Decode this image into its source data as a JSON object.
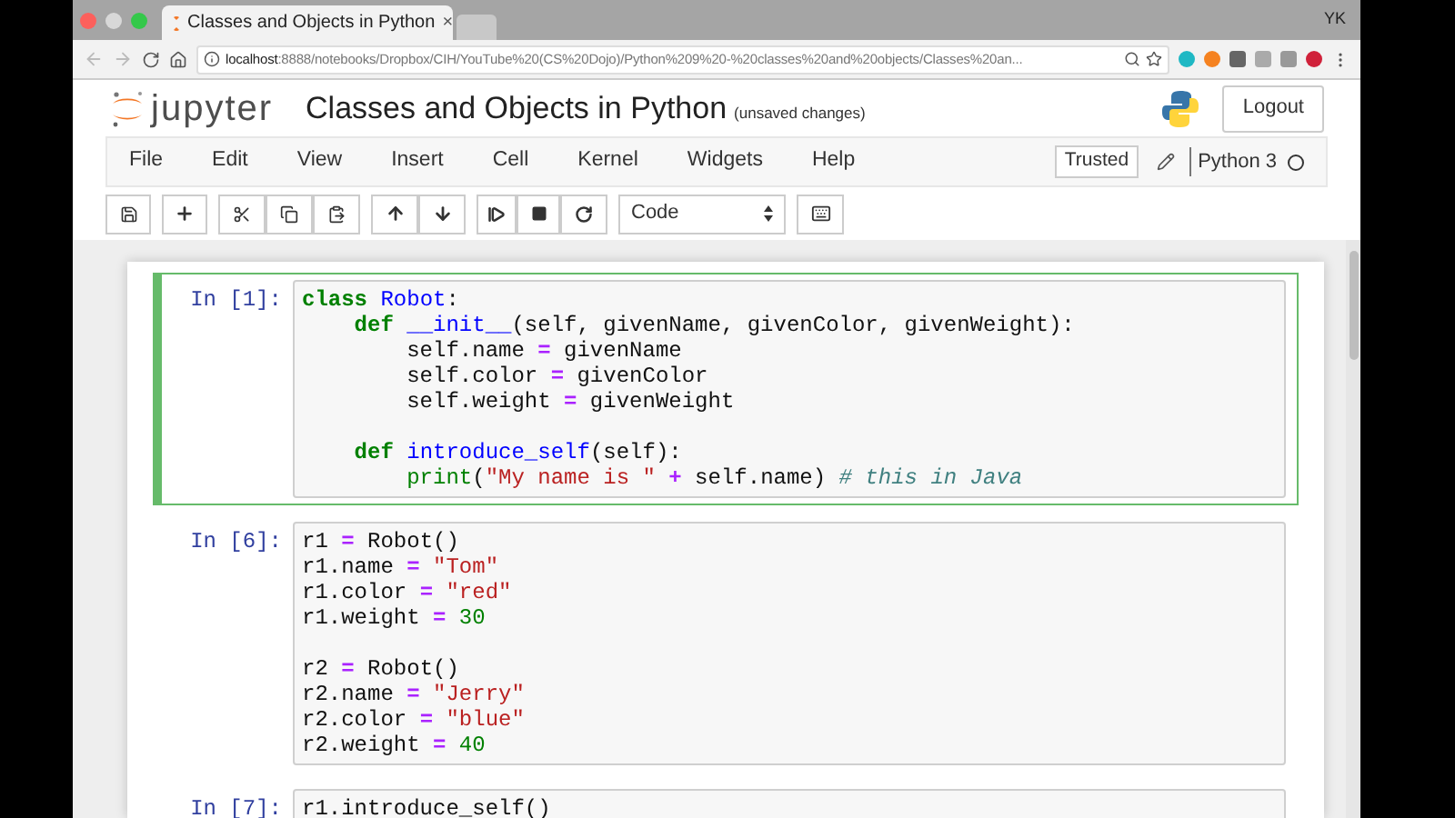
{
  "browser": {
    "tabs": [
      {
        "title": "Classes and Objects in Python",
        "close": "×",
        "selected": true
      },
      {
        "selected": false
      }
    ],
    "profile": "YK",
    "address": {
      "host": "localhost",
      "path": ":8888/notebooks/Dropbox/CIH/YouTube%20(CS%20Dojo)/Python%209%20-%20classes%20and%20objects/Classes%20an..."
    }
  },
  "header": {
    "logo_text": "jupyter",
    "notebook_title": "Classes and Objects in Python",
    "save_status": "(unsaved changes)",
    "logout": "Logout"
  },
  "menu": {
    "items": [
      "File",
      "Edit",
      "View",
      "Insert",
      "Cell",
      "Kernel",
      "Widgets",
      "Help"
    ],
    "trusted": "Trusted",
    "kernel": "Python 3"
  },
  "toolbar": {
    "cell_type": "Code"
  },
  "cells": [
    {
      "prompt": "In [1]:",
      "selected": true,
      "lines": [
        {
          "tokens": [
            {
              "kind": "keyword",
              "t": "class"
            },
            {
              "kind": "name",
              "t": " Robot"
            },
            {
              "kind": "plain",
              "t": ":"
            }
          ]
        },
        {
          "tokens": [
            {
              "kind": "keyword",
              "t": "    def"
            },
            {
              "kind": "name",
              "t": " __init__"
            },
            {
              "kind": "plain",
              "t": "(self, givenName, givenColor, givenWeight):"
            }
          ]
        },
        {
          "tokens": [
            {
              "kind": "plain",
              "t": "        self.name "
            },
            {
              "kind": "operator",
              "t": "="
            },
            {
              "kind": "plain",
              "t": " givenName"
            }
          ]
        },
        {
          "tokens": [
            {
              "kind": "plain",
              "t": "        self.color "
            },
            {
              "kind": "operator",
              "t": "="
            },
            {
              "kind": "plain",
              "t": " givenColor"
            }
          ]
        },
        {
          "tokens": [
            {
              "kind": "plain",
              "t": "        self.weight "
            },
            {
              "kind": "operator",
              "t": "="
            },
            {
              "kind": "plain",
              "t": " givenWeight"
            }
          ]
        },
        {
          "blank_before": true,
          "tokens": [
            {
              "kind": "keyword",
              "t": "    def"
            },
            {
              "kind": "name",
              "t": " introduce_self"
            },
            {
              "kind": "plain",
              "t": "(self):"
            }
          ]
        },
        {
          "tokens": [
            {
              "kind": "builtin",
              "t": "        print"
            },
            {
              "kind": "plain",
              "t": "("
            },
            {
              "kind": "string",
              "t": "\"My name is \""
            },
            {
              "kind": "operator",
              "t": " +"
            },
            {
              "kind": "plain",
              "t": " self.name) "
            },
            {
              "kind": "comment",
              "t": "# this in Java"
            }
          ]
        }
      ]
    },
    {
      "prompt": "In [6]:",
      "selected": false,
      "lines": [
        {
          "tokens": [
            {
              "kind": "plain",
              "t": "r1 "
            },
            {
              "kind": "operator",
              "t": "="
            },
            {
              "kind": "plain",
              "t": " Robot()"
            }
          ]
        },
        {
          "tokens": [
            {
              "kind": "plain",
              "t": "r1.name "
            },
            {
              "kind": "operator",
              "t": "="
            },
            {
              "kind": "string",
              "t": " \"Tom\""
            }
          ]
        },
        {
          "tokens": [
            {
              "kind": "plain",
              "t": "r1.color "
            },
            {
              "kind": "operator",
              "t": "="
            },
            {
              "kind": "string",
              "t": " \"red\""
            }
          ]
        },
        {
          "tokens": [
            {
              "kind": "plain",
              "t": "r1.weight "
            },
            {
              "kind": "operator",
              "t": "="
            },
            {
              "kind": "number",
              "t": " 30"
            }
          ]
        },
        {
          "blank_before": true,
          "tokens": [
            {
              "kind": "plain",
              "t": "r2 "
            },
            {
              "kind": "operator",
              "t": "="
            },
            {
              "kind": "plain",
              "t": " Robot()"
            }
          ]
        },
        {
          "tokens": [
            {
              "kind": "plain",
              "t": "r2.name "
            },
            {
              "kind": "operator",
              "t": "="
            },
            {
              "kind": "string",
              "t": " \"Jerry\""
            }
          ]
        },
        {
          "tokens": [
            {
              "kind": "plain",
              "t": "r2.color "
            },
            {
              "kind": "operator",
              "t": "="
            },
            {
              "kind": "string",
              "t": " \"blue\""
            }
          ]
        },
        {
          "tokens": [
            {
              "kind": "plain",
              "t": "r2.weight "
            },
            {
              "kind": "operator",
              "t": "="
            },
            {
              "kind": "number",
              "t": " 40"
            }
          ]
        }
      ]
    },
    {
      "prompt": "In [7]:",
      "selected": false,
      "lines": [
        {
          "tokens": [
            {
              "kind": "plain",
              "t": "r1.introduce_self()"
            }
          ]
        }
      ]
    }
  ]
}
